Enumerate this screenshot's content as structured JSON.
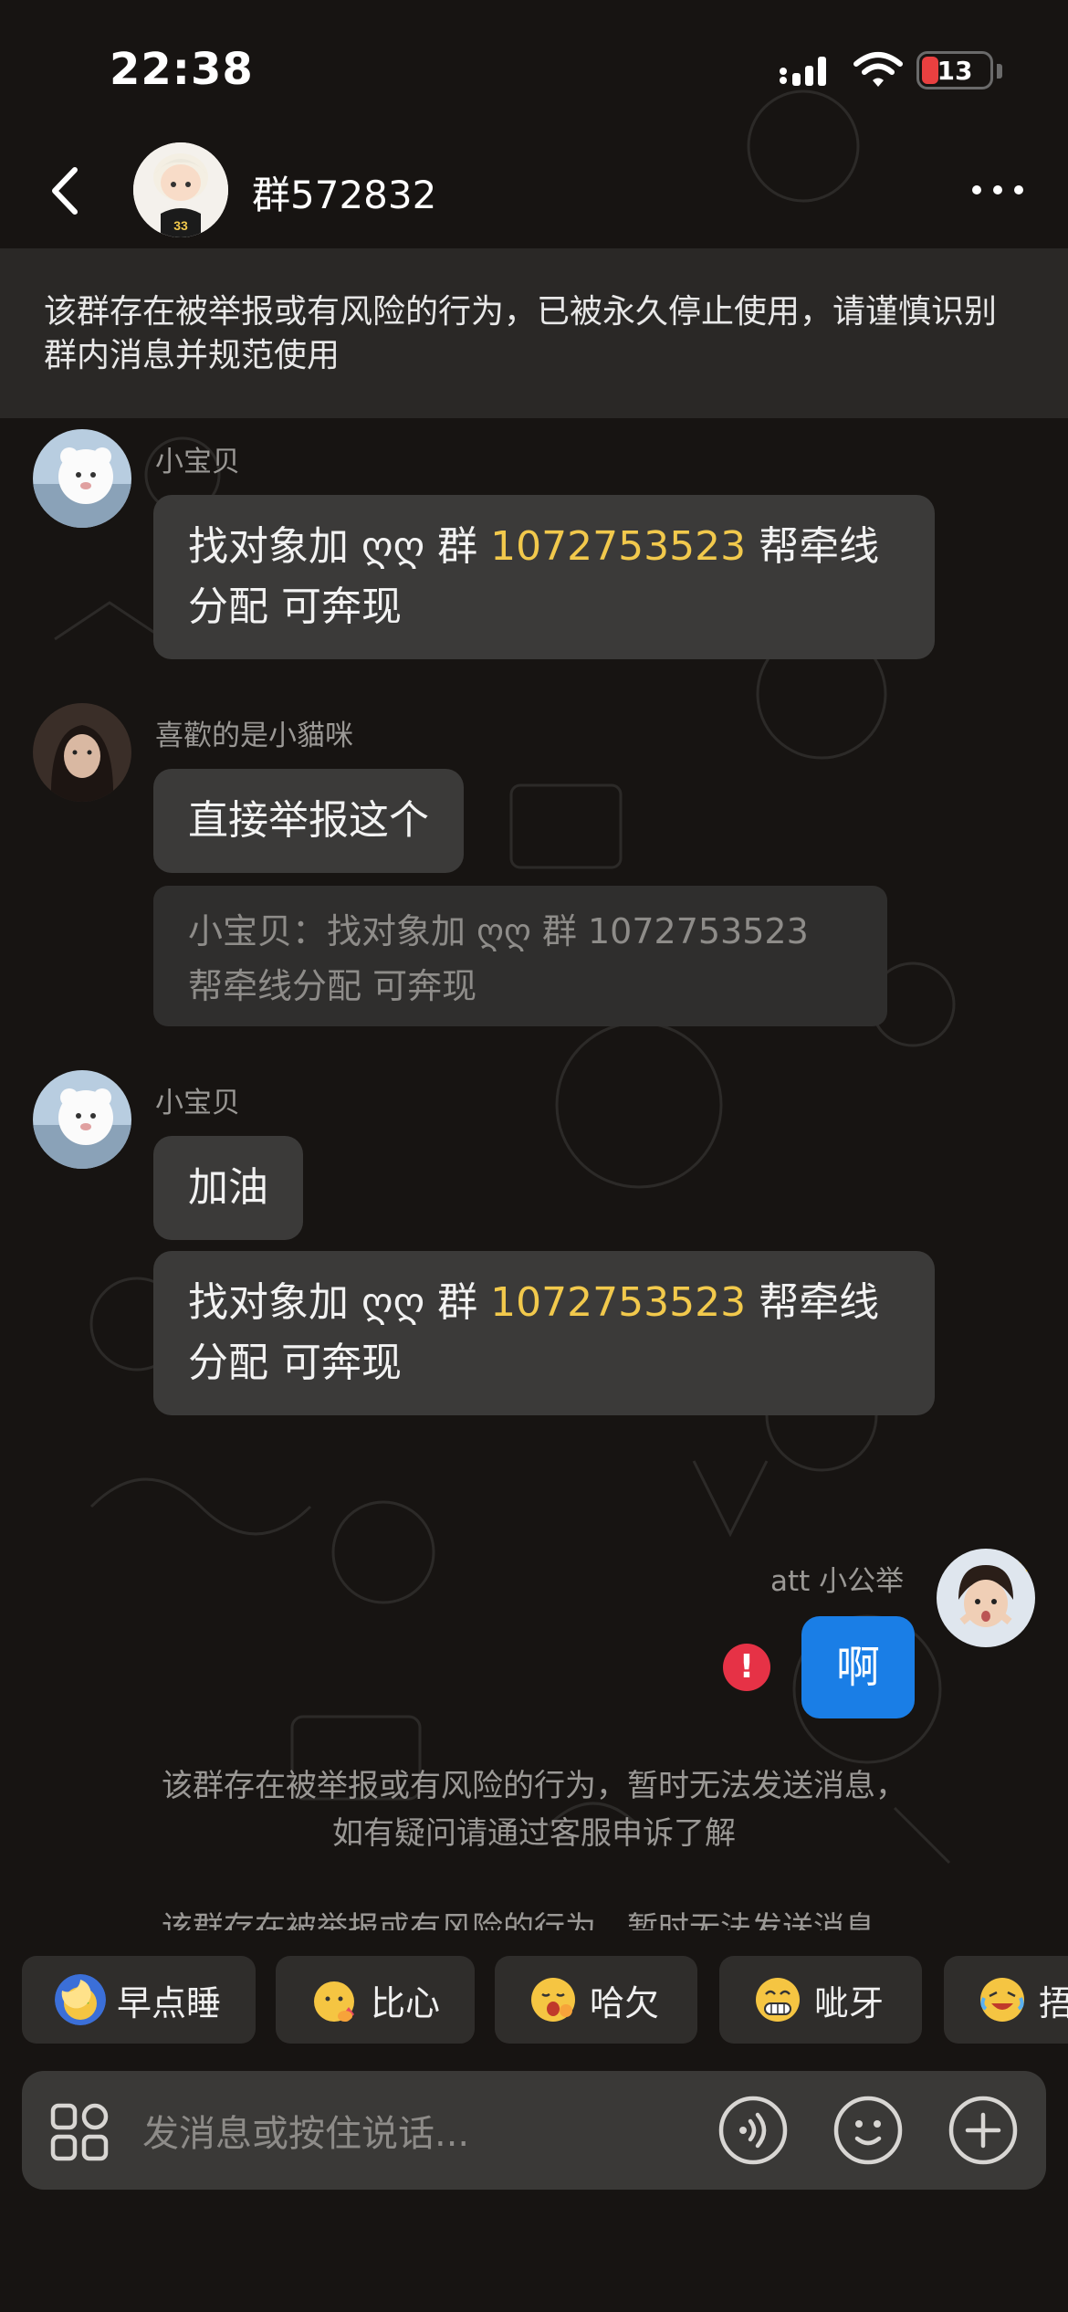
{
  "status_bar": {
    "time": "22:38",
    "battery": "13"
  },
  "header": {
    "title": "群572832"
  },
  "warning_banner": "该群存在被举报或有风险的行为，已被永久停止使用，请谨慎识别群内消息并规范使用",
  "messages": [
    {
      "sender": "小宝贝",
      "text_before": "找对象加 ღღ 群 ",
      "number": "1072753523",
      "text_after": " 帮牵线分配 可奔现"
    },
    {
      "sender": "喜歡的是小貓咪",
      "text": "直接举报这个",
      "quote": "小宝贝：找对象加 ღღ 群 1072753523 帮牵线分配 可奔现"
    },
    {
      "sender": "小宝贝",
      "text": "加油",
      "text2_before": "找对象加 ღღ 群 ",
      "number2": "1072753523",
      "text2_after": " 帮牵线分配 可奔现"
    },
    {
      "sender": "att 小公举",
      "text": "啊",
      "error_mark": "!"
    }
  ],
  "notices": [
    "该群存在被举报或有风险的行为，暂时无法发送消息，",
    "如有疑问请通过客服申诉了解",
    "该群存在被举报或有风险的行为，暂时无法发送消息，"
  ],
  "quick_reactions": [
    "早点睡",
    "比心",
    "哈欠",
    "呲牙",
    "捂"
  ],
  "input": {
    "placeholder": "发消息或按住说话..."
  },
  "colors": {
    "background": "#171412",
    "bubble": "#3b3a39",
    "self_bubble": "#1a7ee6",
    "highlight_number": "#f2c94c",
    "error": "#e63246"
  }
}
